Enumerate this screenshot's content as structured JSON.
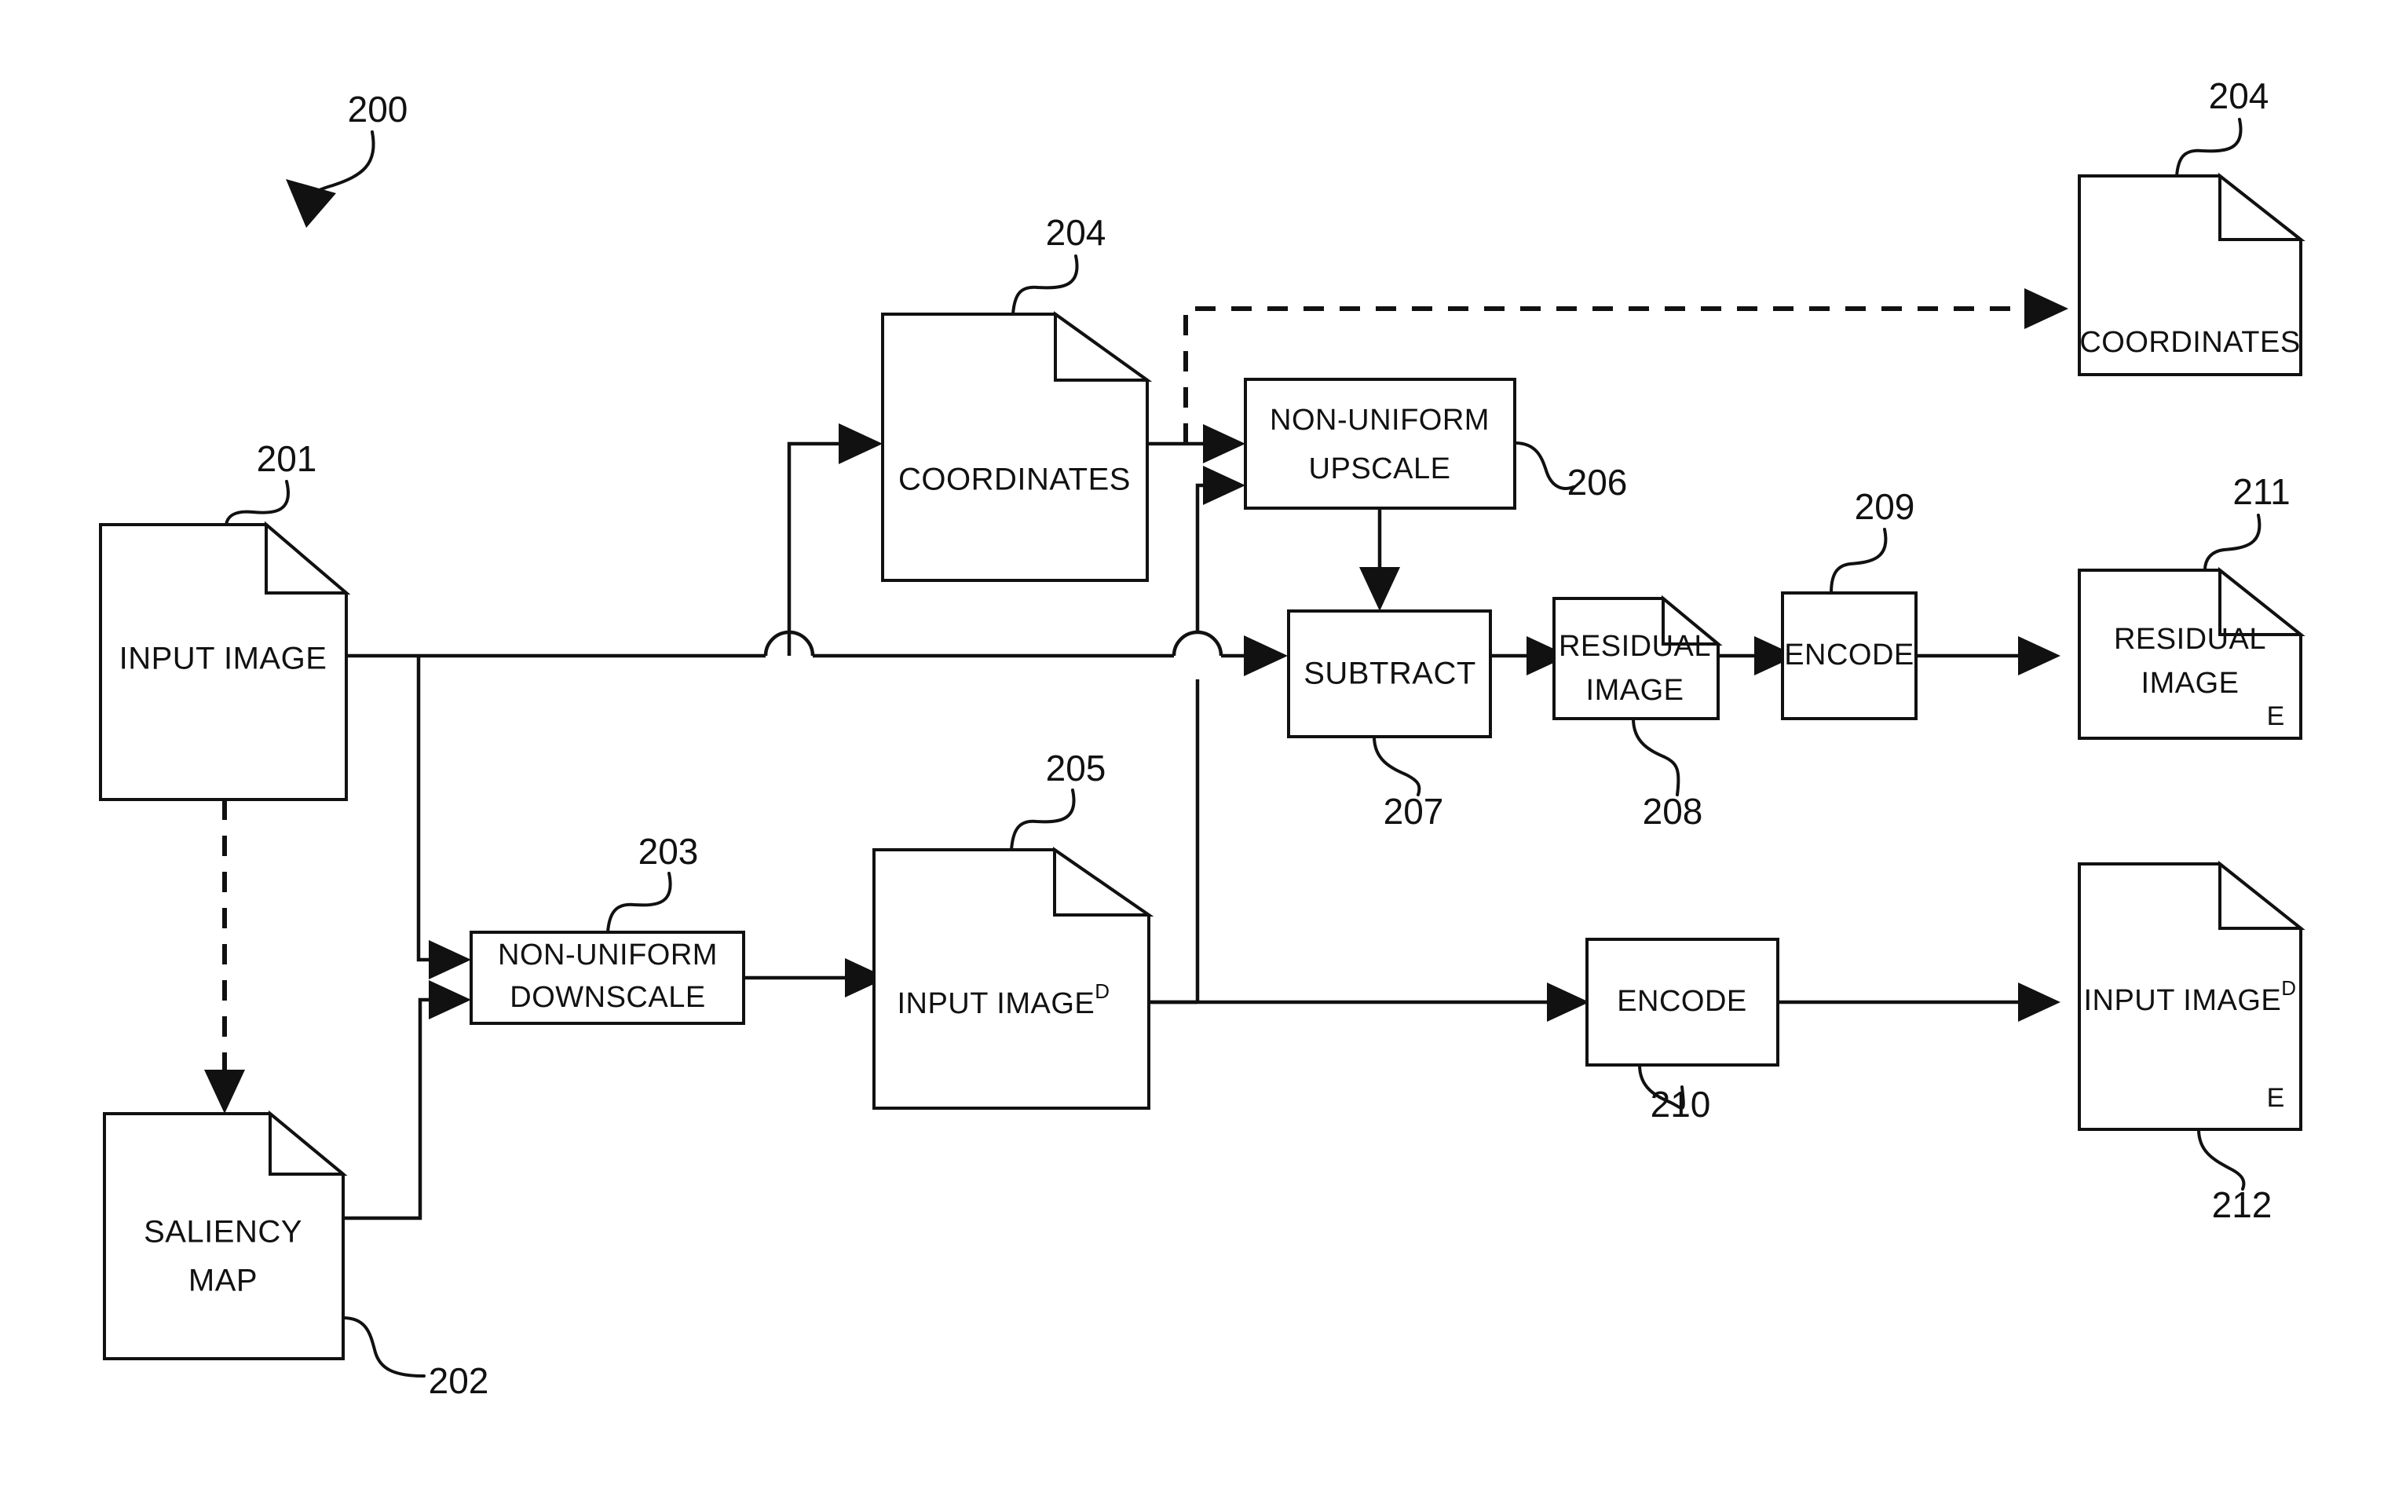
{
  "figure": {
    "number": "200",
    "nodes": {
      "input_image": {
        "label": "INPUT IMAGE",
        "ref": "201"
      },
      "saliency_map": {
        "label_line1": "SALIENCY",
        "label_line2": "MAP",
        "ref": "202"
      },
      "non_uniform_downscale": {
        "label_line1": "NON-UNIFORM",
        "label_line2": "DOWNSCALE",
        "ref": "203"
      },
      "coordinates_mid": {
        "label": "COORDINATES",
        "ref": "204"
      },
      "coordinates_out": {
        "label": "COORDINATES",
        "ref": "204"
      },
      "input_image_d": {
        "label": "INPUT IMAGE",
        "superscript": "D",
        "ref": "205"
      },
      "non_uniform_upscale": {
        "label_line1": "NON-UNIFORM",
        "label_line2": "UPSCALE",
        "ref": "206"
      },
      "subtract": {
        "label": "SUBTRACT",
        "ref": "207"
      },
      "residual_image": {
        "label_line1": "RESIDUAL",
        "label_line2": "IMAGE",
        "ref": "208"
      },
      "encode_top": {
        "label": "ENCODE",
        "ref": "209"
      },
      "encode_bottom": {
        "label": "ENCODE",
        "ref": "210"
      },
      "residual_image_encoded": {
        "label_line1": "RESIDUAL",
        "label_line2": "IMAGE",
        "corner_mark": "E",
        "ref": "211"
      },
      "input_image_d_encoded": {
        "label": "INPUT IMAGE",
        "superscript": "D",
        "corner_mark": "E",
        "ref": "212"
      }
    },
    "colors": {
      "stroke": "#111111",
      "background": "#ffffff"
    }
  }
}
